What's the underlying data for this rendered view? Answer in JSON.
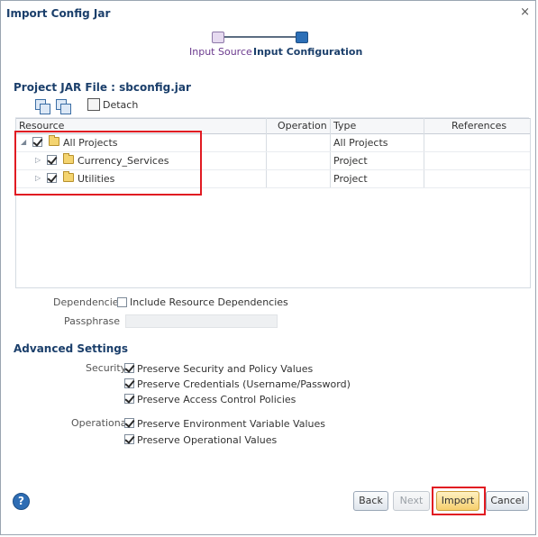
{
  "dialog": {
    "title": "Import Config Jar",
    "close_glyph": "×"
  },
  "train": {
    "steps": [
      "Input Source",
      "Input Configuration"
    ]
  },
  "project": {
    "heading": "Project JAR File : sbconfig.jar",
    "toolbar": {
      "detach_label": "Detach"
    },
    "columns": [
      "Resource",
      "Operation",
      "Type",
      "References"
    ],
    "rows": [
      {
        "name": "All Projects",
        "type": "All Projects",
        "checked": true,
        "expander": "◢"
      },
      {
        "name": "Currency_Services",
        "type": "Project",
        "checked": true,
        "expander": "▷"
      },
      {
        "name": "Utilities",
        "type": "Project",
        "checked": true,
        "expander": "▷"
      }
    ]
  },
  "form": {
    "dependencies_label": "Dependencies",
    "include_dependencies_label": "Include Resource Dependencies",
    "passphrase_label": "Passphrase"
  },
  "advanced": {
    "heading": "Advanced Settings",
    "security_label": "Security",
    "security_options": [
      "Preserve Security and Policy Values",
      "Preserve Credentials (Username/Password)",
      "Preserve Access Control Policies"
    ],
    "operational_label": "Operational",
    "operational_options": [
      "Preserve Environment Variable Values",
      "Preserve Operational Values"
    ]
  },
  "buttons": {
    "help": "?",
    "back": "Back",
    "next": "Next",
    "import": "Import",
    "cancel": "Cancel"
  },
  "colors": {
    "accent": "#1b3f6b",
    "highlight": "#e11b22",
    "primary_button": "#f6cf6d"
  }
}
